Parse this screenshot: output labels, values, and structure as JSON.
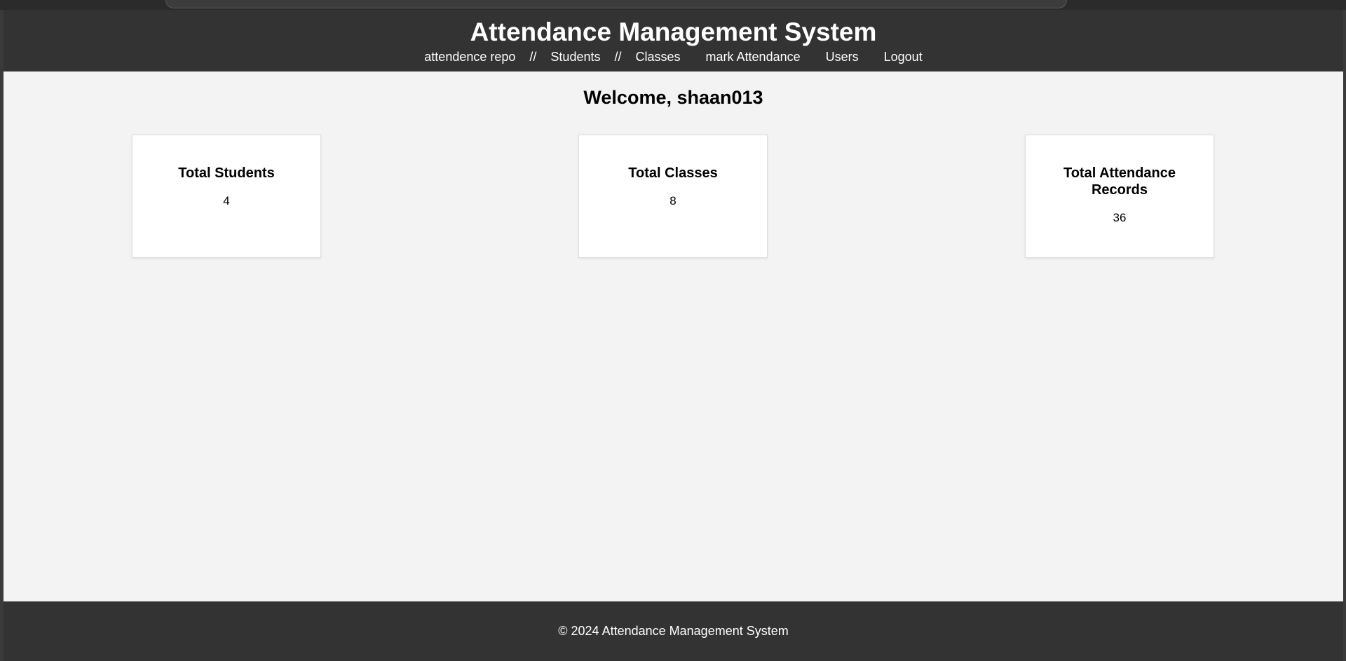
{
  "header": {
    "title": "Attendance Management System",
    "nav": {
      "attendance_repo": "attendence repo",
      "separator": "//",
      "students": "Students",
      "classes": "Classes",
      "mark_attendance": "mark Attendance",
      "users": "Users",
      "logout": "Logout"
    }
  },
  "main": {
    "welcome": "Welcome, shaan013",
    "cards": [
      {
        "title": "Total Students",
        "value": "4"
      },
      {
        "title": "Total Classes",
        "value": "8"
      },
      {
        "title": "Total Attendance Records",
        "value": "36"
      }
    ]
  },
  "footer": {
    "text": "© 2024 Attendance Management System"
  },
  "colors": {
    "header_bg": "#333333",
    "page_bg": "#f3f3f3",
    "card_bg": "#ffffff"
  }
}
